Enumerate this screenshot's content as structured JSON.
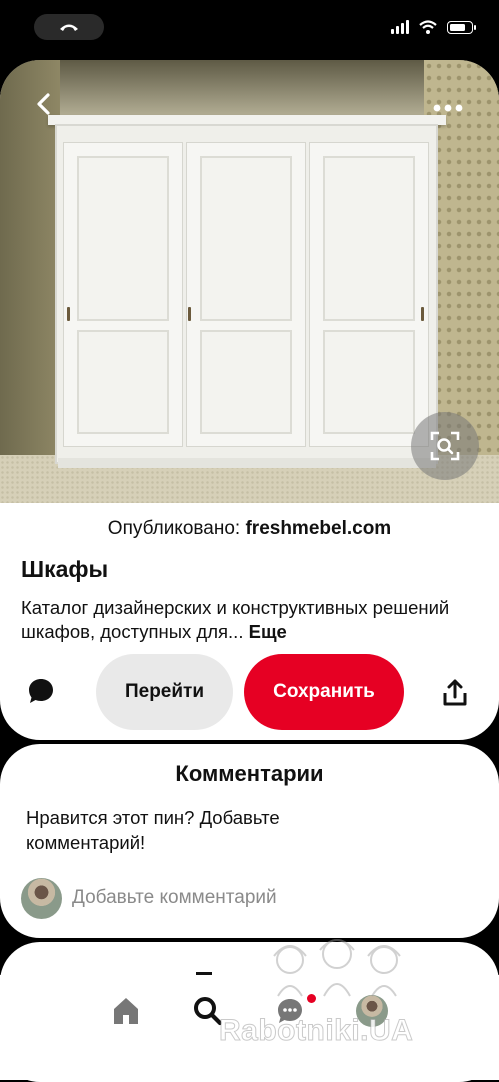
{
  "status_bar": {
    "call_indicator_icon": "phone-icon",
    "signal_icon": "cellular-signal-icon",
    "wifi_icon": "wifi-icon",
    "battery_icon": "battery-icon",
    "battery_level": 0.8
  },
  "pin": {
    "back_icon": "chevron-left-icon",
    "more_icon": "more-dots-icon",
    "visual_search_icon": "visual-search-icon",
    "publisher_prefix": "Опубликовано:",
    "publisher_name": "freshmebel.com",
    "title": "Шкафы",
    "description": "Каталог дизайнерских и конструктивных решений шкафов, доступных для...",
    "more_label": "Еще",
    "comment_icon": "speech-bubble-icon",
    "go_button": "Перейти",
    "save_button": "Сохранить",
    "share_icon": "share-icon",
    "save_color": "#e60023"
  },
  "comments": {
    "title": "Комментарии",
    "prompt": "Нравится этот пин? Добавьте комментарий!",
    "input_placeholder": "Добавьте комментарий"
  },
  "nav": {
    "items": [
      {
        "name": "home",
        "icon": "home-icon"
      },
      {
        "name": "search",
        "icon": "search-icon"
      },
      {
        "name": "messages",
        "icon": "chat-bubble-icon",
        "badge": true
      },
      {
        "name": "profile",
        "icon": "avatar"
      }
    ]
  },
  "watermark": {
    "text": "Rabotniki.UA"
  }
}
